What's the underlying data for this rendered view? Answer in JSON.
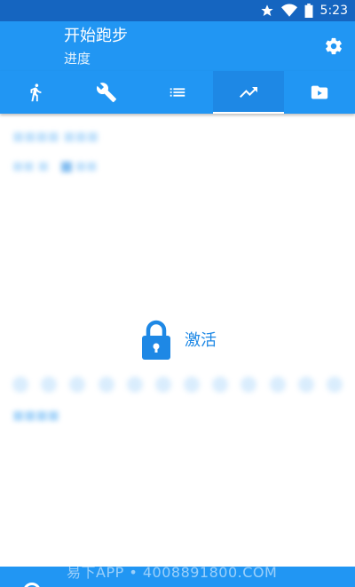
{
  "status_bar": {
    "time": "5:23",
    "icons": [
      "star-icon",
      "wifi-icon",
      "battery-icon"
    ]
  },
  "app_bar": {
    "title": "开始跑步",
    "subtitle": "进度",
    "settings_icon": "gear-icon"
  },
  "tabs": [
    {
      "icon": "run-icon",
      "active": false
    },
    {
      "icon": "wrench-icon",
      "active": false
    },
    {
      "icon": "list-icon",
      "active": false
    },
    {
      "icon": "trending-up-icon",
      "active": true
    },
    {
      "icon": "video-icon",
      "active": false
    }
  ],
  "content": {
    "unlock_label": "激活",
    "lock_icon": "lock-icon"
  },
  "footer": {
    "watermark": "易下APP • 4008891800.COM"
  },
  "colors": {
    "primary": "#2196f3",
    "primary_dark": "#1565c0",
    "accent_text": "#1e88e5"
  }
}
